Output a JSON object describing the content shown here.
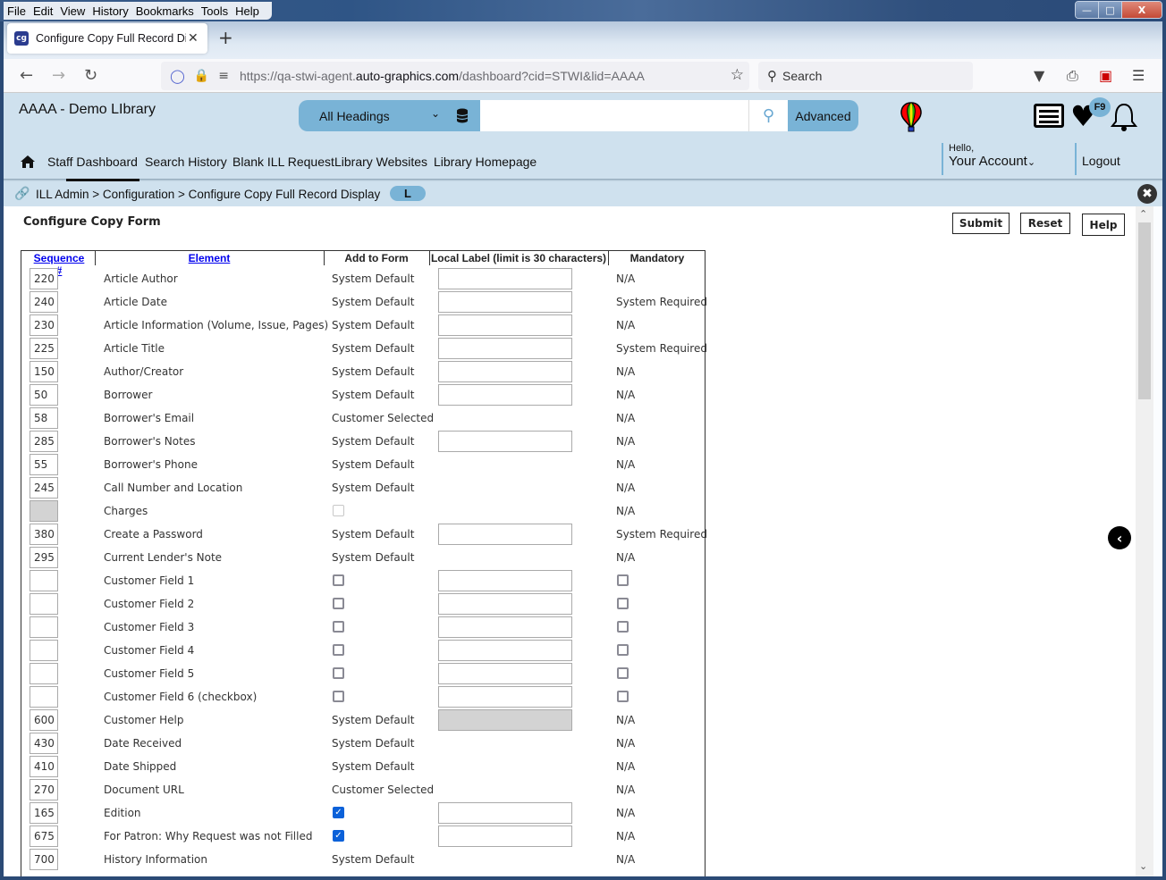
{
  "browser": {
    "menu": [
      "File",
      "Edit",
      "View",
      "History",
      "Bookmarks",
      "Tools",
      "Help"
    ],
    "tab_title": "Configure Copy Full Record Disp",
    "tab_favicon": "cg",
    "url_prefix": "https://qa-stwi-agent.",
    "url_domain": "auto-graphics.com",
    "url_suffix": "/dashboard?cid=STWI&lid=AAAA",
    "search_placeholder": "Search"
  },
  "header": {
    "library_name": "AAAA - Demo LIbrary",
    "search_scope": "All Headings",
    "search_value": "",
    "advanced_label": "Advanced",
    "badge": "F9",
    "hello": "Hello,",
    "account": "Your Account",
    "logout": "Logout"
  },
  "nav": {
    "items": [
      "Staff Dashboard",
      "Search History",
      "Blank ILL Request",
      "Library Websites",
      "Library Homepage"
    ],
    "active": "Staff Dashboard"
  },
  "breadcrumb": {
    "path": "ILL Admin > Configuration > Configure Copy Full Record Display",
    "pill": "L"
  },
  "page": {
    "title": "Configure Copy Form",
    "buttons": {
      "submit": "Submit",
      "reset": "Reset",
      "help": "Help"
    },
    "columns": [
      "Sequence #",
      "Element",
      "Add to Form",
      "Local Label (limit is 30 characters)",
      "Mandatory"
    ],
    "rows": [
      {
        "seq": "220",
        "element": "Article Author",
        "add": "System Default",
        "label_input": true,
        "mandatory": "N/A"
      },
      {
        "seq": "240",
        "element": "Article Date",
        "add": "System Default",
        "label_input": true,
        "mandatory": "System Required"
      },
      {
        "seq": "230",
        "element": "Article Information (Volume, Issue, Pages)",
        "add": "System Default",
        "label_input": true,
        "mandatory": "N/A"
      },
      {
        "seq": "225",
        "element": "Article Title",
        "add": "System Default",
        "label_input": true,
        "mandatory": "System Required"
      },
      {
        "seq": "150",
        "element": "Author/Creator",
        "add": "System Default",
        "label_input": true,
        "mandatory": "N/A"
      },
      {
        "seq": "50",
        "element": "Borrower",
        "add": "System Default",
        "label_input": true,
        "mandatory": "N/A"
      },
      {
        "seq": "58",
        "element": "Borrower's Email",
        "add": "Customer Selected",
        "label_input": false,
        "mandatory": "N/A"
      },
      {
        "seq": "285",
        "element": "Borrower's Notes",
        "add": "System Default",
        "label_input": true,
        "mandatory": "N/A"
      },
      {
        "seq": "55",
        "element": "Borrower's Phone",
        "add": "System Default",
        "label_input": false,
        "mandatory": "N/A"
      },
      {
        "seq": "245",
        "element": "Call Number and Location",
        "add": "System Default",
        "label_input": false,
        "mandatory": "N/A"
      },
      {
        "seq": "",
        "seq_disabled": true,
        "element": "Charges",
        "add_checkbox": "disabled",
        "label_input": false,
        "mandatory": "N/A"
      },
      {
        "seq": "380",
        "element": "Create a Password",
        "add": "System Default",
        "label_input": true,
        "mandatory": "System Required"
      },
      {
        "seq": "295",
        "element": "Current Lender's Note",
        "add": "System Default",
        "label_input": false,
        "mandatory": "N/A"
      },
      {
        "seq": "",
        "element": "Customer Field 1",
        "add_checkbox": "unchecked",
        "label_input": true,
        "mandatory_checkbox": "unchecked"
      },
      {
        "seq": "",
        "element": "Customer Field 2",
        "add_checkbox": "unchecked",
        "label_input": true,
        "mandatory_checkbox": "unchecked"
      },
      {
        "seq": "",
        "element": "Customer Field 3",
        "add_checkbox": "unchecked",
        "label_input": true,
        "mandatory_checkbox": "unchecked"
      },
      {
        "seq": "",
        "element": "Customer Field 4",
        "add_checkbox": "unchecked",
        "label_input": true,
        "mandatory_checkbox": "unchecked"
      },
      {
        "seq": "",
        "element": "Customer Field 5",
        "add_checkbox": "unchecked",
        "label_input": true,
        "mandatory_checkbox": "unchecked"
      },
      {
        "seq": "",
        "element": "Customer Field 6 (checkbox)",
        "add_checkbox": "unchecked",
        "label_input": true,
        "mandatory_checkbox": "unchecked"
      },
      {
        "seq": "600",
        "element": "Customer Help",
        "add": "System Default",
        "label_input": "disabled",
        "mandatory": "N/A"
      },
      {
        "seq": "430",
        "element": "Date Received",
        "add": "System Default",
        "label_input": false,
        "mandatory": "N/A"
      },
      {
        "seq": "410",
        "element": "Date Shipped",
        "add": "System Default",
        "label_input": false,
        "mandatory": "N/A"
      },
      {
        "seq": "270",
        "element": "Document URL",
        "add": "Customer Selected",
        "label_input": false,
        "mandatory": "N/A"
      },
      {
        "seq": "165",
        "element": "Edition",
        "add_checkbox": "checked",
        "label_input": true,
        "mandatory": "N/A"
      },
      {
        "seq": "675",
        "element": "For Patron: Why Request was not Filled",
        "add_checkbox": "checked",
        "label_input": true,
        "mandatory": "N/A"
      },
      {
        "seq": "700",
        "element": "History Information",
        "add": "System Default",
        "label_input": false,
        "mandatory": "N/A"
      }
    ]
  },
  "colors": {
    "header_bg": "#cfe1ee",
    "accent": "#79b3d6",
    "checkbox_checked": "#0b61d9",
    "link": "#0000ee"
  },
  "icons": {
    "home": "home-icon",
    "breadcrumb": "link-icon",
    "database": "database-icon",
    "balloon": "balloon-icon",
    "list": "list-icon",
    "heart": "heart-icon",
    "bell": "bell-icon",
    "close": "close-icon",
    "collapse": "chevron-left-icon"
  }
}
